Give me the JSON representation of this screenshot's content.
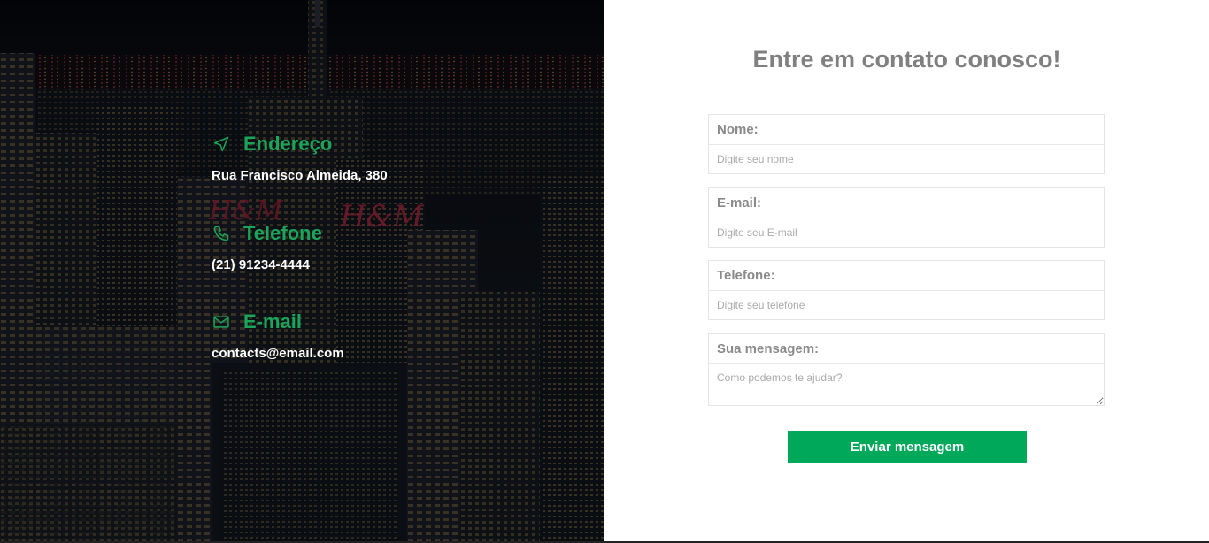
{
  "contact": {
    "address": {
      "title": "Endereço",
      "text": "Rua Francisco Almeida, 380",
      "icon": "navigation-arrow-icon"
    },
    "phone": {
      "title": "Telefone",
      "text": "(21) 91234-4444",
      "icon": "phone-icon"
    },
    "email": {
      "title": "E-mail",
      "text": "contacts@email.com",
      "icon": "envelope-icon"
    }
  },
  "form": {
    "title": "Entre em contato conosco!",
    "name_label": "Nome:",
    "name_placeholder": "Digite seu nome",
    "email_label": "E-mail:",
    "email_placeholder": "Digite seu E-mail",
    "phone_label": "Telefone:",
    "phone_placeholder": "Digite seu telefone",
    "message_label": "Sua mensagem:",
    "message_placeholder": "Como podemos te ajudar?",
    "submit_label": "Enviar mensagem"
  },
  "background": {
    "sign_1": "H&M",
    "sign_2": "H&M"
  },
  "colors": {
    "accent": "#1aa55a",
    "button": "#00a85a",
    "title": "#808080"
  }
}
